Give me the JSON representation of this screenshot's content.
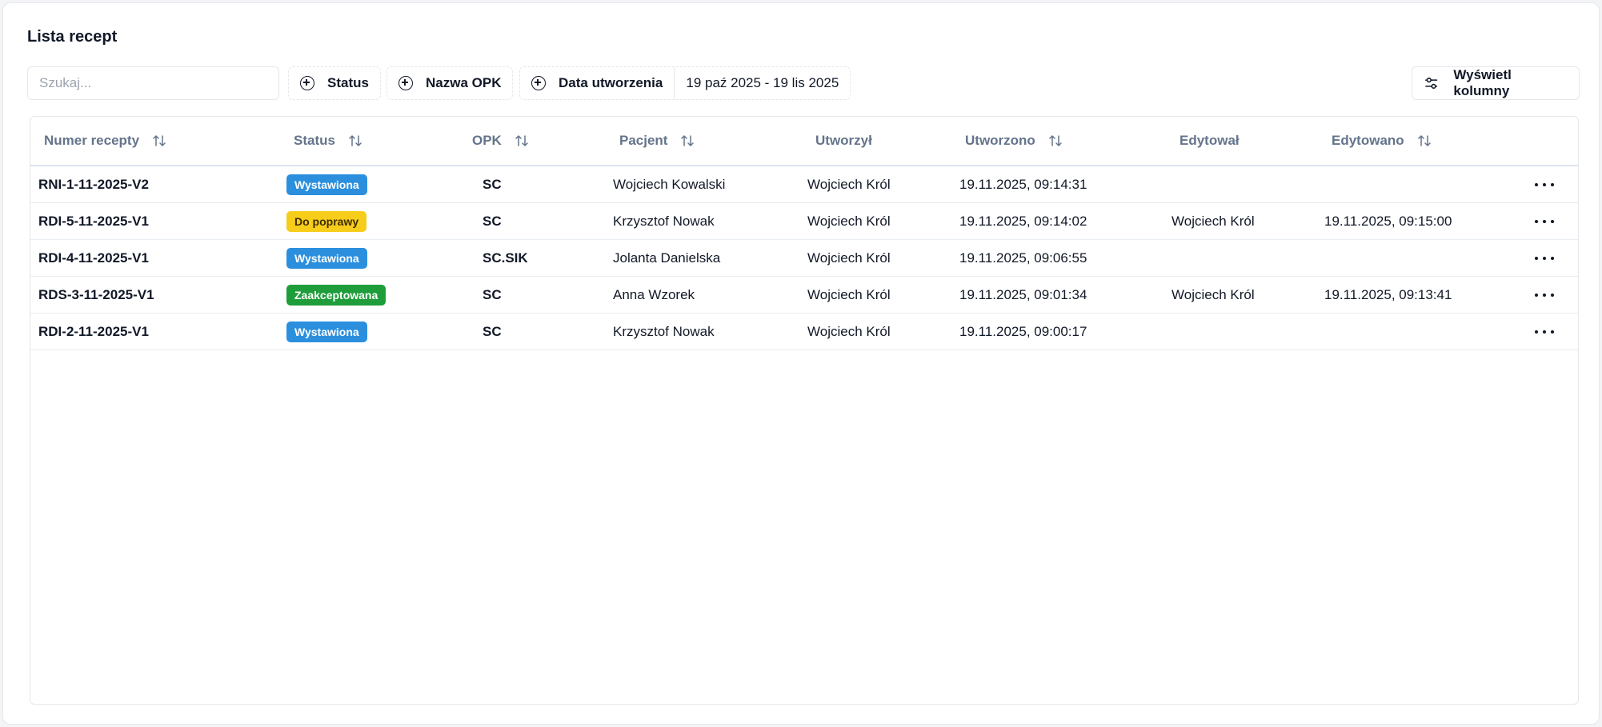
{
  "page": {
    "title": "Lista recept"
  },
  "toolbar": {
    "search_placeholder": "Szukaj...",
    "filters": {
      "status": "Status",
      "opk": "Nazwa OPK",
      "created": "Data utworzenia",
      "created_range": "19 paź 2025 - 19 lis 2025"
    },
    "columns_button": "Wyświetl kolumny"
  },
  "table": {
    "columns": {
      "number": "Numer recepty",
      "status": "Status",
      "opk": "OPK",
      "patient": "Pacjent",
      "created_by": "Utworzył",
      "created_at": "Utworzono",
      "edited_by": "Edytował",
      "edited_at": "Edytowano"
    },
    "rows": [
      {
        "number": "RNI-1-11-2025-V2",
        "status": "Wystawiona",
        "status_color": "#2b8fde",
        "opk": "SC",
        "patient": "Wojciech Kowalski",
        "created_by": "Wojciech Król",
        "created_at": "19.11.2025, 09:14:31",
        "edited_by": "",
        "edited_at": ""
      },
      {
        "number": "RDI-5-11-2025-V1",
        "status": "Do poprawy",
        "status_color": "#f7cd1b",
        "opk": "SC",
        "patient": "Krzysztof Nowak",
        "created_by": "Wojciech Król",
        "created_at": "19.11.2025, 09:14:02",
        "edited_by": "Wojciech Król",
        "edited_at": "19.11.2025, 09:15:00"
      },
      {
        "number": "RDI-4-11-2025-V1",
        "status": "Wystawiona",
        "status_color": "#2b8fde",
        "opk": "SC.SIK",
        "patient": "Jolanta Danielska",
        "created_by": "Wojciech Król",
        "created_at": "19.11.2025, 09:06:55",
        "edited_by": "",
        "edited_at": ""
      },
      {
        "number": "RDS-3-11-2025-V1",
        "status": "Zaakceptowana",
        "status_color": "#1f9d3a",
        "opk": "SC",
        "patient": "Anna Wzorek",
        "created_by": "Wojciech Król",
        "created_at": "19.11.2025, 09:01:34",
        "edited_by": "Wojciech Król",
        "edited_at": "19.11.2025, 09:13:41"
      },
      {
        "number": "RDI-2-11-2025-V1",
        "status": "Wystawiona",
        "status_color": "#2b8fde",
        "opk": "SC",
        "patient": "Krzysztof Nowak",
        "created_by": "Wojciech Król",
        "created_at": "19.11.2025, 09:00:17",
        "edited_by": "",
        "edited_at": ""
      }
    ]
  }
}
